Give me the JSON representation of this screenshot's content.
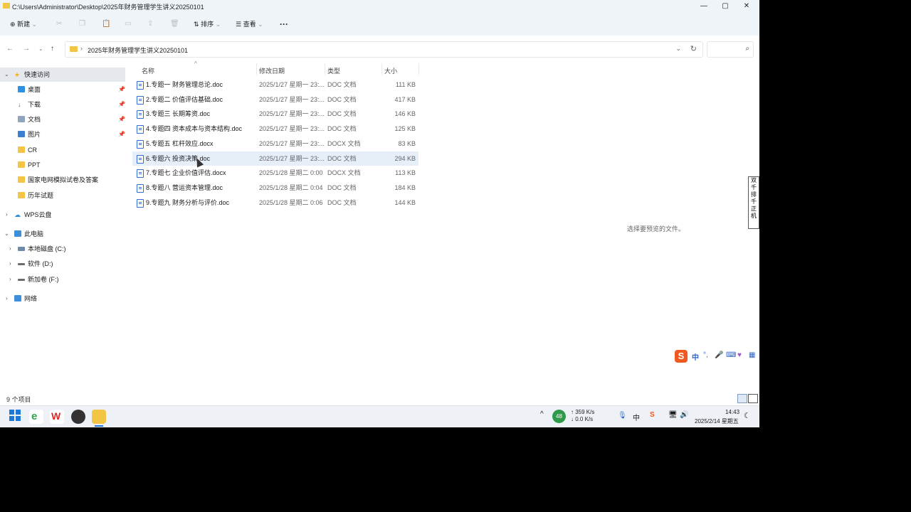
{
  "window": {
    "title": "C:\\Users\\Administrator\\Desktop\\2025年财务管理学生讲义20250101",
    "controls": {
      "minimize": "—",
      "maximize": "▢",
      "close": "✕"
    }
  },
  "toolbar": {
    "new_label": "新建",
    "sort_label": "排序",
    "view_label": "查看",
    "more_label": "···"
  },
  "address": {
    "path": "2025年财务管理学生讲义20250101",
    "search_placeholder": ""
  },
  "sidebar": {
    "quick_access": "快速访问",
    "quick_items": [
      {
        "label": "桌面",
        "pinned": true,
        "icon": "desktop-icon"
      },
      {
        "label": "下载",
        "pinned": true,
        "icon": "download-icon"
      },
      {
        "label": "文档",
        "pinned": true,
        "icon": "document-icon"
      },
      {
        "label": "图片",
        "pinned": true,
        "icon": "picture-icon"
      },
      {
        "label": "CR",
        "pinned": false,
        "icon": "folder-icon"
      },
      {
        "label": "PPT",
        "pinned": false,
        "icon": "folder-icon"
      },
      {
        "label": "国家电网模拟试卷及答案",
        "pinned": false,
        "icon": "folder-icon"
      },
      {
        "label": "历年试题",
        "pinned": false,
        "icon": "folder-icon"
      }
    ],
    "wps": "WPS云盘",
    "this_pc": "此电脑",
    "drives": [
      "本地磁盘 (C:)",
      "软件 (D:)",
      "新加卷 (F:)"
    ],
    "network": "网络"
  },
  "columns": {
    "name": "名称",
    "date": "修改日期",
    "type": "类型",
    "size": "大小"
  },
  "files": [
    {
      "name": "1.专题一  财务管理总论.doc",
      "date": "2025/1/27 星期一 23:...",
      "type": "DOC 文档",
      "size": "111 KB"
    },
    {
      "name": "2.专题二  价值评估基础.doc",
      "date": "2025/1/27 星期一 23:...",
      "type": "DOC 文档",
      "size": "417 KB"
    },
    {
      "name": "3.专题三  长期筹资.doc",
      "date": "2025/1/27 星期一 23:...",
      "type": "DOC 文档",
      "size": "146 KB"
    },
    {
      "name": "4.专题四  资本成本与资本结构.doc",
      "date": "2025/1/27 星期一 23:...",
      "type": "DOC 文档",
      "size": "125 KB"
    },
    {
      "name": "5.专题五  杠杆效应.docx",
      "date": "2025/1/27 星期一 23:...",
      "type": "DOCX 文档",
      "size": "83 KB"
    },
    {
      "name": "6.专题六  投资决策.doc",
      "date": "2025/1/27 星期一 23:...",
      "type": "DOC 文档",
      "size": "294 KB"
    },
    {
      "name": "7.专题七  企业价值评估.docx",
      "date": "2025/1/28 星期二 0:00",
      "type": "DOCX 文档",
      "size": "113 KB"
    },
    {
      "name": "8.专题八  营运资本管理.doc",
      "date": "2025/1/28 星期二 0:04",
      "type": "DOC 文档",
      "size": "184 KB"
    },
    {
      "name": "9.专题九  财务分析与评价.doc",
      "date": "2025/1/28 星期二 0:06",
      "type": "DOC 文档",
      "size": "144 KB"
    }
  ],
  "selected_index": 5,
  "preview_message": "选择要预览的文件。",
  "status": {
    "item_count": "9 个项目"
  },
  "side_strip": [
    "双",
    "千",
    "排",
    "千",
    "正",
    "机"
  ],
  "ime": {
    "lang": "中",
    "punct": "°,",
    "voice": "🎤",
    "keyboard": "⌨"
  },
  "taskbar": {
    "cpu_badge": "48",
    "net_up": "↑ 359 K/s",
    "net_down": "↓ 0.0 K/s",
    "tray_lang": "中",
    "time": "14:43",
    "date": "2025/2/14 星期五"
  },
  "colors": {
    "accent": "#1c78d4",
    "selected_row": "#e6eef8",
    "folder": "#f3c544",
    "doc": "#2f6cd5"
  }
}
